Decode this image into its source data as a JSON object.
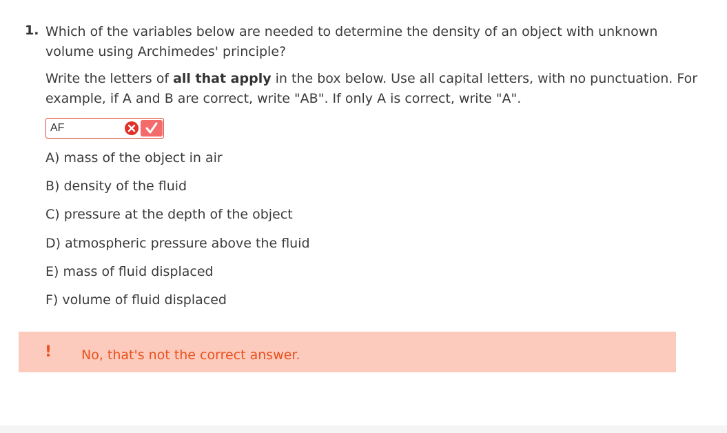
{
  "question": {
    "number": "1.",
    "text": "Which of the variables below are needed to determine the density of an object with unknown volume using Archimedes' principle?"
  },
  "instructions": {
    "before_bold": "Write the letters of ",
    "bold": "all that apply",
    "after_bold": " in the box below. Use all capital letters, with no punctuation. For example, if A and B are correct, write \"AB\". If only A is correct, write \"A\"."
  },
  "answer": {
    "value": "AF",
    "status": "incorrect",
    "status_color": "#e0322a"
  },
  "options": [
    "A) mass of the object in air",
    "B) density of the fluid",
    "C) pressure at the depth of the object",
    "D) atmospheric pressure above the fluid",
    "E) mass of fluid displaced",
    "F) volume of fluid displaced"
  ],
  "feedback": {
    "icon": "!",
    "text": "No, that's not the correct answer.",
    "background": "#fdcbbd",
    "color": "#e8501c"
  }
}
